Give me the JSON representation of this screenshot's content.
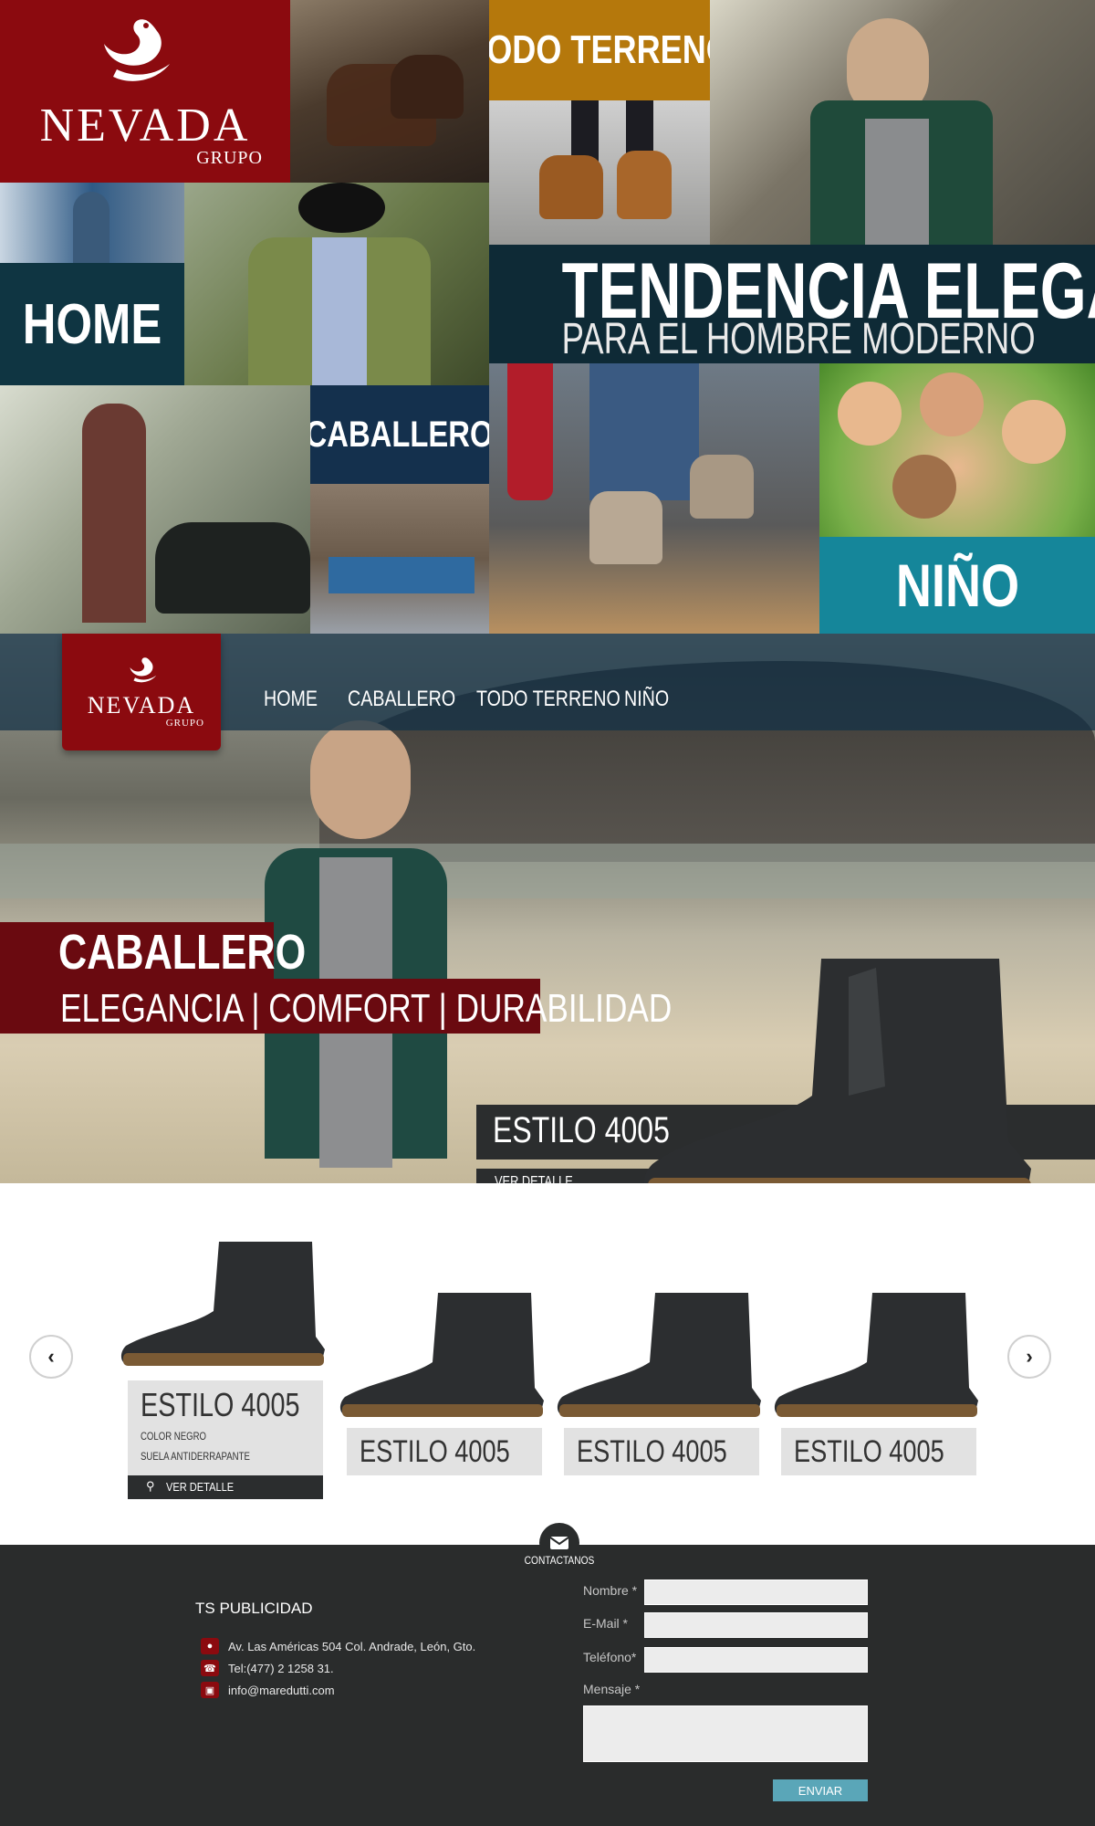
{
  "brand": {
    "name": "NEVADA",
    "sub": "GRUPO"
  },
  "mosaic": {
    "todo_terreno": "TODO TERRENO",
    "home": "HOME",
    "caballero": "CABALLERO",
    "nino": "NIÑO",
    "headline": "TENDENCIA ELEGANTE",
    "subheadline": "PARA EL HOMBRE MODERNO"
  },
  "nav": {
    "items": [
      "HOME",
      "CABALLERO",
      "TODO TERRENO",
      "NIÑO"
    ]
  },
  "hero": {
    "title": "CABALLERO",
    "tagline": "ELEGANCIA | COMFORT | DURABILIDAD",
    "product_name": "ESTILO 4005",
    "detail_button": "VER DETALLE"
  },
  "products": {
    "items": [
      {
        "name": "ESTILO 4005",
        "line1": "COLOR NEGRO",
        "line2": "SUELA ANTIDERRAPANTE",
        "button": "VER DETALLE"
      },
      {
        "name": "ESTILO 4005"
      },
      {
        "name": "ESTILO 4005"
      },
      {
        "name": "ESTILO 4005"
      }
    ]
  },
  "footer": {
    "contact_title": "CONTACTANOS",
    "company": "TS PUBLICIDAD",
    "address": "Av. Las Américas  504 Col. Andrade, León, Gto.",
    "phone": "Tel:(477) 2 1258 31.",
    "email": "info@maredutti.com",
    "form": {
      "nombre_label": "Nombre *",
      "email_label": "E-Mail *",
      "telefono_label": "Teléfono*",
      "mensaje_label": "Mensaje *",
      "submit": "ENVIAR"
    }
  },
  "colors": {
    "brand_red": "#8b0a0f",
    "mustard": "#b5780c",
    "dark_teal": "#0f3542",
    "navy": "#14304d",
    "teal": "#15869a",
    "footer_bg": "#2a2c2c",
    "button_blue": "#5aa6b8"
  },
  "icons": [
    "swan-logo-icon",
    "chevron-left-icon",
    "chevron-right-icon",
    "search-icon",
    "envelope-icon",
    "location-pin-icon",
    "phone-icon",
    "laptop-icon"
  ]
}
